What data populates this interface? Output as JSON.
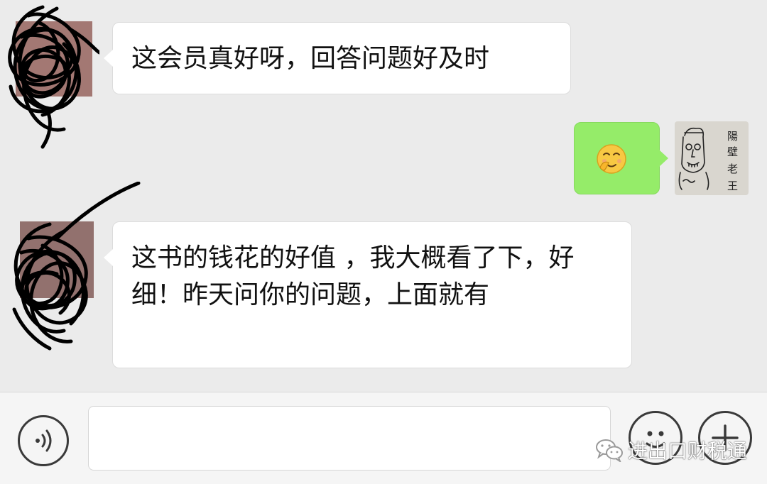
{
  "chat": {
    "messages": [
      {
        "side": "left",
        "text": "这会员真好呀，回答问题好及时"
      },
      {
        "side": "right",
        "emoji": "embarrassed-grin-emoji"
      },
      {
        "side": "left",
        "text": "这书的钱花的好值 ，我大概看了下，好细！昨天问你的问题，上面就有"
      }
    ],
    "self_avatar_text": "陽 壁 老 王"
  },
  "input_bar": {
    "text_value": "",
    "voice_icon": "voice-waves-icon",
    "emoji_icon": "smiley-face-icon",
    "plus_icon": "plus-icon"
  },
  "watermark": {
    "text": "进出口财税通",
    "icon": "wechat-icon"
  },
  "colors": {
    "chat_background": "#ebebeb",
    "incoming_bubble": "#ffffff",
    "outgoing_bubble": "#95ec69",
    "input_bar": "#f5f5f5"
  }
}
